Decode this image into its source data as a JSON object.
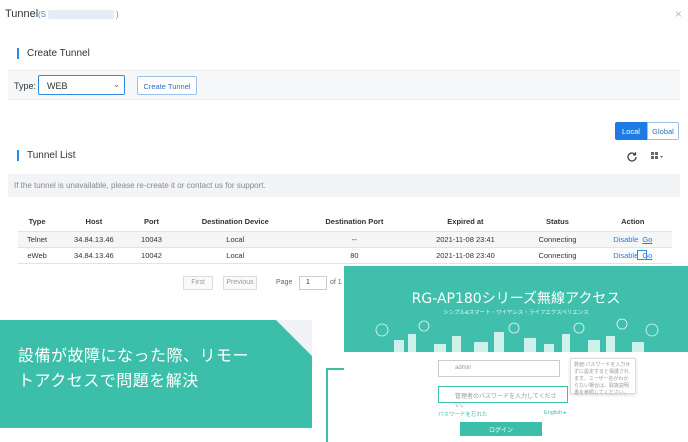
{
  "modal": {
    "title": "Tunnel",
    "sn_prefix": "(S",
    "sn_suffix": ")",
    "close": "×"
  },
  "create": {
    "section_title": "Create Tunnel",
    "type_label": "Type:",
    "type_value": "WEB",
    "create_button": "Create Tunnel"
  },
  "list": {
    "scope_local": "Local",
    "scope_global": "Global",
    "section_title": "Tunnel List",
    "notice": "If the tunnel is unavailable, please re-create it or contact us for support.",
    "columns": [
      "Type",
      "Host",
      "Port",
      "Destination Device",
      "Destination Port",
      "Expired at",
      "Status",
      "Action"
    ],
    "rows": [
      {
        "type": "Telnet",
        "host": "34.84.13.46",
        "port": "10043",
        "device": "Local",
        "dport": "--",
        "expired": "2021-11-08 23:41",
        "status": "Connecting",
        "disable": "Disable",
        "go": "Go"
      },
      {
        "type": "eWeb",
        "host": "34.84.13.46",
        "port": "10042",
        "device": "Local",
        "dport": "80",
        "expired": "2021-11-08 23:40",
        "status": "Connecting",
        "disable": "Disable",
        "go": "Go"
      }
    ],
    "pager": {
      "first": "First",
      "previous": "Previous",
      "page_label": "Page",
      "page_value": "1",
      "of": "of 1"
    }
  },
  "ad": {
    "line1": "設備が故障になった際、リモー",
    "line2": "トアクセスで問題を解決"
  },
  "mobile": {
    "title": "RG-AP180シリーズ無線アクセス",
    "subtitle": "シンプル&スマート・ワイヤレス・ライフエクスペリエンス",
    "user_value": "admin",
    "pass_placeholder": "管理者のパスワードを入力してください。",
    "tip": "数値:パスワードを入力せずに設定すると保護されます。ユーザー名がわからない場合は、取扱説明書を参照してください。",
    "forgot": "パスワードを忘れた",
    "lang": "English ▸",
    "login": "ログイン"
  },
  "colors": {
    "accent": "#1e7be3",
    "teal": "#3cbfaa"
  }
}
